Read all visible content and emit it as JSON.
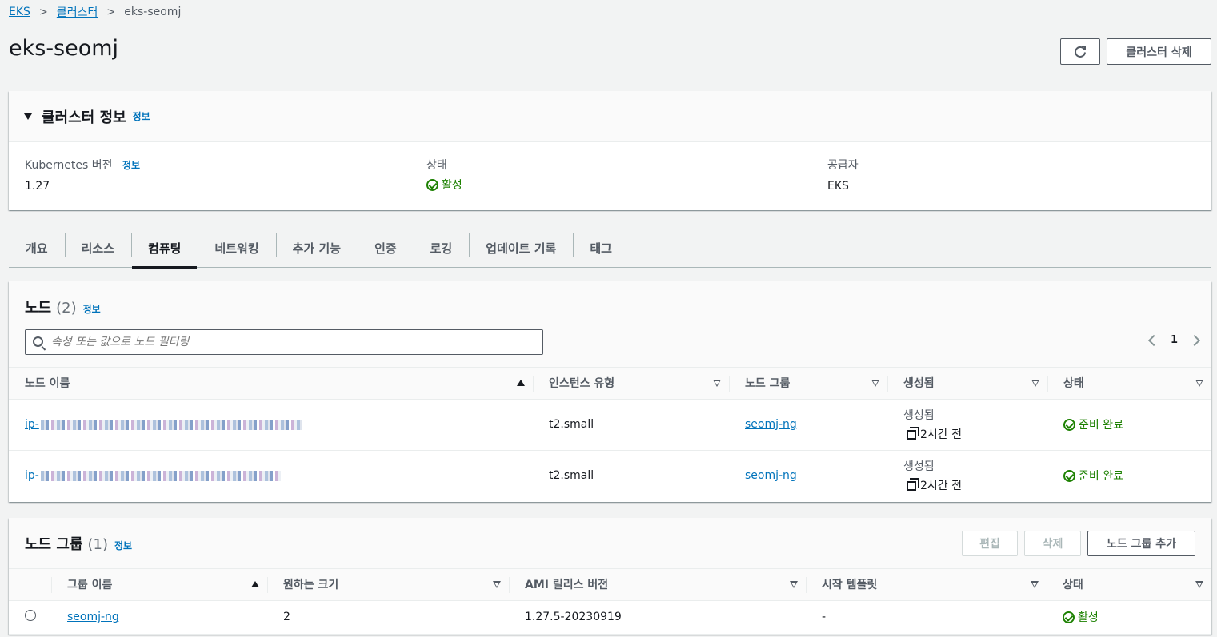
{
  "breadcrumb": {
    "items": [
      "EKS",
      "클러스터"
    ],
    "current": "eks-seomj"
  },
  "page": {
    "title": "eks-seomj",
    "delete_cluster_label": "클러스터 삭제"
  },
  "info_link": "정보",
  "cluster_info": {
    "title": "클러스터 정보",
    "fields": [
      {
        "label": "Kubernetes 버전",
        "value": "1.27"
      },
      {
        "label": "상태",
        "value": "활성"
      },
      {
        "label": "공급자",
        "value": "EKS"
      }
    ]
  },
  "tabs": [
    "개요",
    "리소스",
    "컴퓨팅",
    "네트워킹",
    "추가 기능",
    "인증",
    "로깅",
    "업데이트 기록",
    "태그"
  ],
  "active_tab": "컴퓨팅",
  "nodes": {
    "title": "노드",
    "count": "(2)",
    "filter_placeholder": "속성 또는 값으로 노드 필터링",
    "page": "1",
    "columns": [
      "노드 이름",
      "인스턴스 유형",
      "노드 그룹",
      "생성됨",
      "상태"
    ],
    "rows": [
      {
        "name_prefix": "ip-",
        "instance_type": "t2.small",
        "node_group": "seomj-ng",
        "created_label": "생성됨",
        "created_ago": "2시간 전",
        "status": "준비 완료"
      },
      {
        "name_prefix": "ip-",
        "instance_type": "t2.small",
        "node_group": "seomj-ng",
        "created_label": "생성됨",
        "created_ago": "2시간 전",
        "status": "준비 완료"
      }
    ]
  },
  "node_groups": {
    "title": "노드 그룹",
    "count": "(1)",
    "edit_label": "편집",
    "delete_label": "삭제",
    "add_label": "노드 그룹 추가",
    "columns": [
      "그룹 이름",
      "원하는 크기",
      "AMI 릴리스 버전",
      "시작 템플릿",
      "상태"
    ],
    "rows": [
      {
        "name": "seomj-ng",
        "desired_size": "2",
        "ami_version": "1.27.5-20230919",
        "launch_template": "-",
        "status": "활성"
      }
    ]
  },
  "colors": {
    "link": "#0073bb",
    "success": "#1d8102",
    "text": "#16191f",
    "muted": "#545b64"
  }
}
